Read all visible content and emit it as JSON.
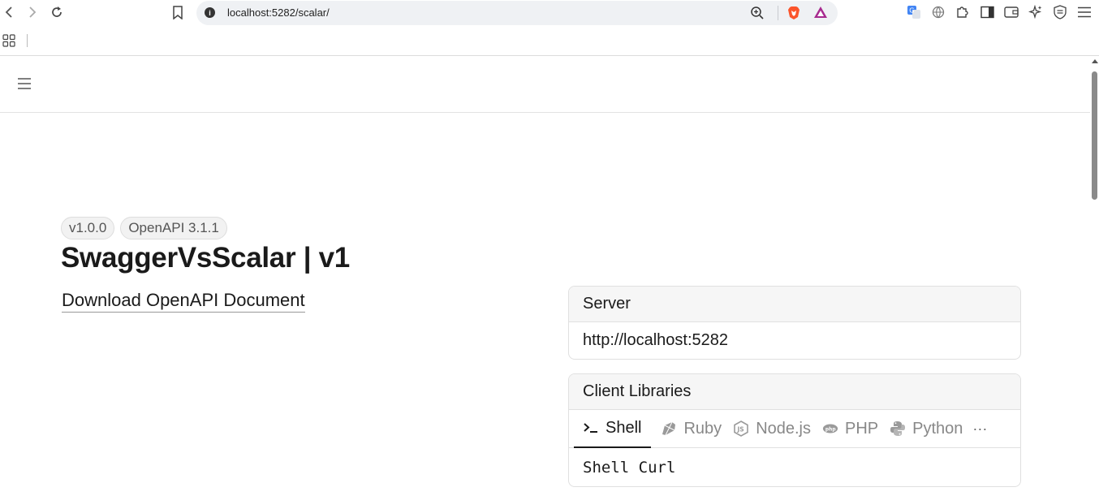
{
  "browser": {
    "url": "localhost:5282/scalar/"
  },
  "page": {
    "badges": [
      "v1.0.0",
      "OpenAPI 3.1.1"
    ],
    "title": "SwaggerVsScalar | v1",
    "download_link": "Download OpenAPI Document",
    "server": {
      "heading": "Server",
      "url": "http://localhost:5282"
    },
    "client_libraries": {
      "heading": "Client Libraries",
      "tabs": [
        {
          "label": "Shell",
          "icon": "terminal-icon",
          "active": true
        },
        {
          "label": "Ruby",
          "icon": "ruby-icon",
          "active": false
        },
        {
          "label": "Node.js",
          "icon": "nodejs-icon",
          "active": false
        },
        {
          "label": "PHP",
          "icon": "php-icon",
          "active": false
        },
        {
          "label": "Python",
          "icon": "python-icon",
          "active": false
        }
      ],
      "more_label": "···",
      "selected_client": "Shell Curl"
    }
  },
  "colors": {
    "accent": "#1a1a1a",
    "muted": "#888888",
    "card_header_bg": "#f6f6f6",
    "border": "#e0e0e0"
  }
}
